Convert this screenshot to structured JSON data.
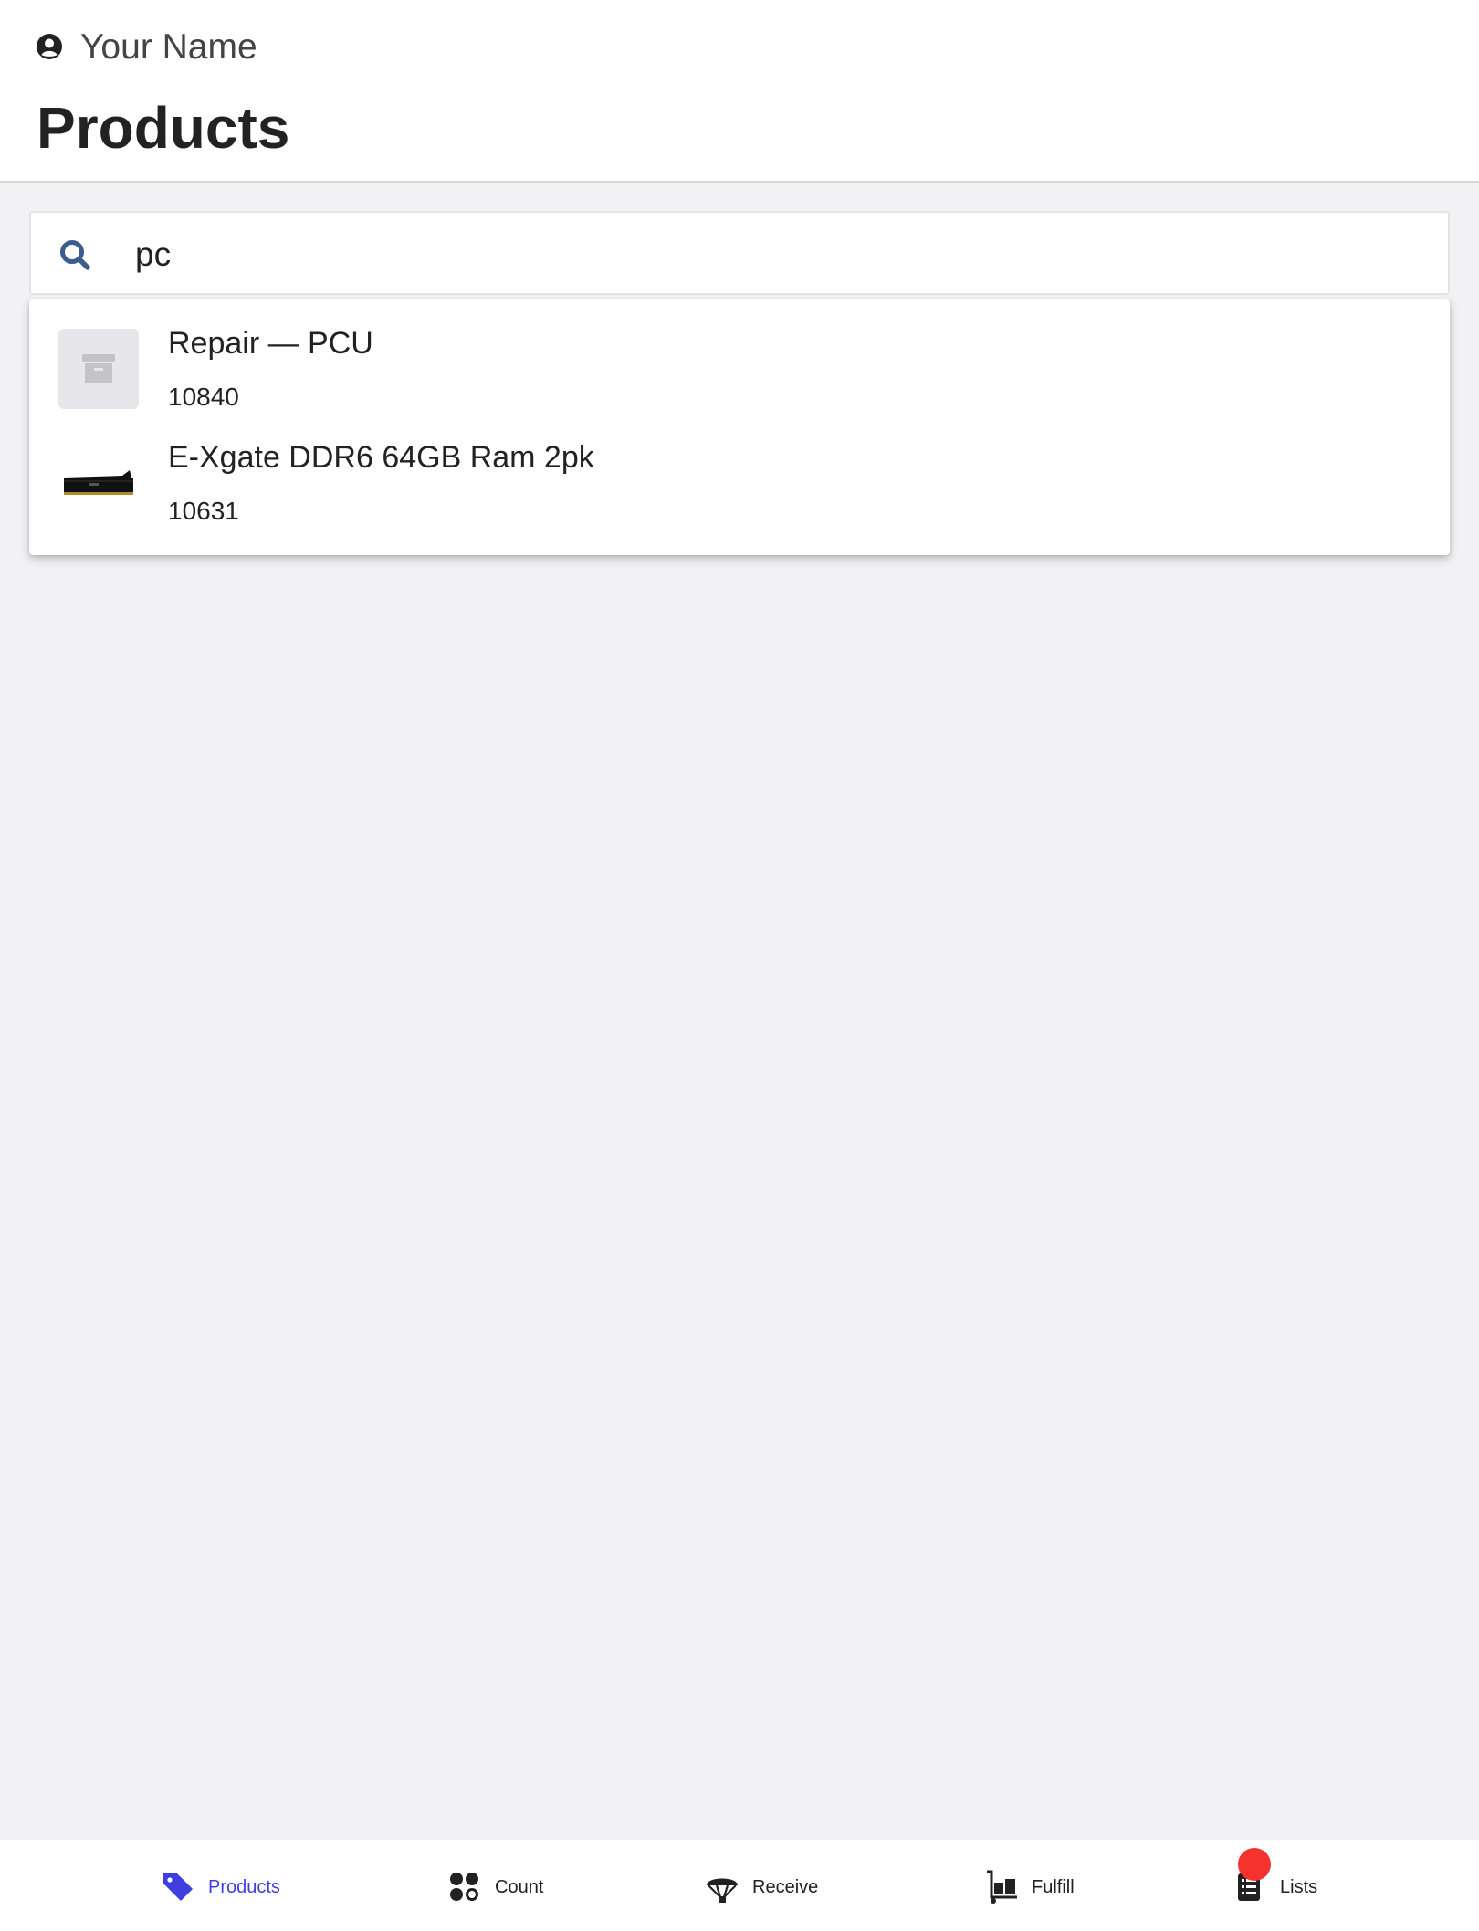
{
  "header": {
    "user_name": "Your Name",
    "user_icon": "user-circle-icon",
    "title": "Products"
  },
  "search": {
    "value": "pc",
    "icon": "search-icon"
  },
  "results": [
    {
      "name": "Repair — PCU",
      "sku": "10840",
      "thumbnail": "archive-box-icon"
    },
    {
      "name": "E-Xgate DDR6 64GB Ram 2pk",
      "sku": "10631",
      "thumbnail": "ram-stick-image"
    }
  ],
  "tabbar": {
    "tabs": [
      {
        "label": "Products",
        "icon": "tag-icon",
        "active": true
      },
      {
        "label": "Count",
        "icon": "count-dots-icon",
        "active": false
      },
      {
        "label": "Receive",
        "icon": "parachute-icon",
        "active": false
      },
      {
        "label": "Fulfill",
        "icon": "dolly-icon",
        "active": false
      },
      {
        "label": "Lists",
        "icon": "list-icon",
        "active": false
      }
    ],
    "lists_badge_color": "#f5332e"
  },
  "colors": {
    "accent": "#3f3fe0",
    "search_icon": "#3a5f8f",
    "background": "#f2f1f4"
  }
}
